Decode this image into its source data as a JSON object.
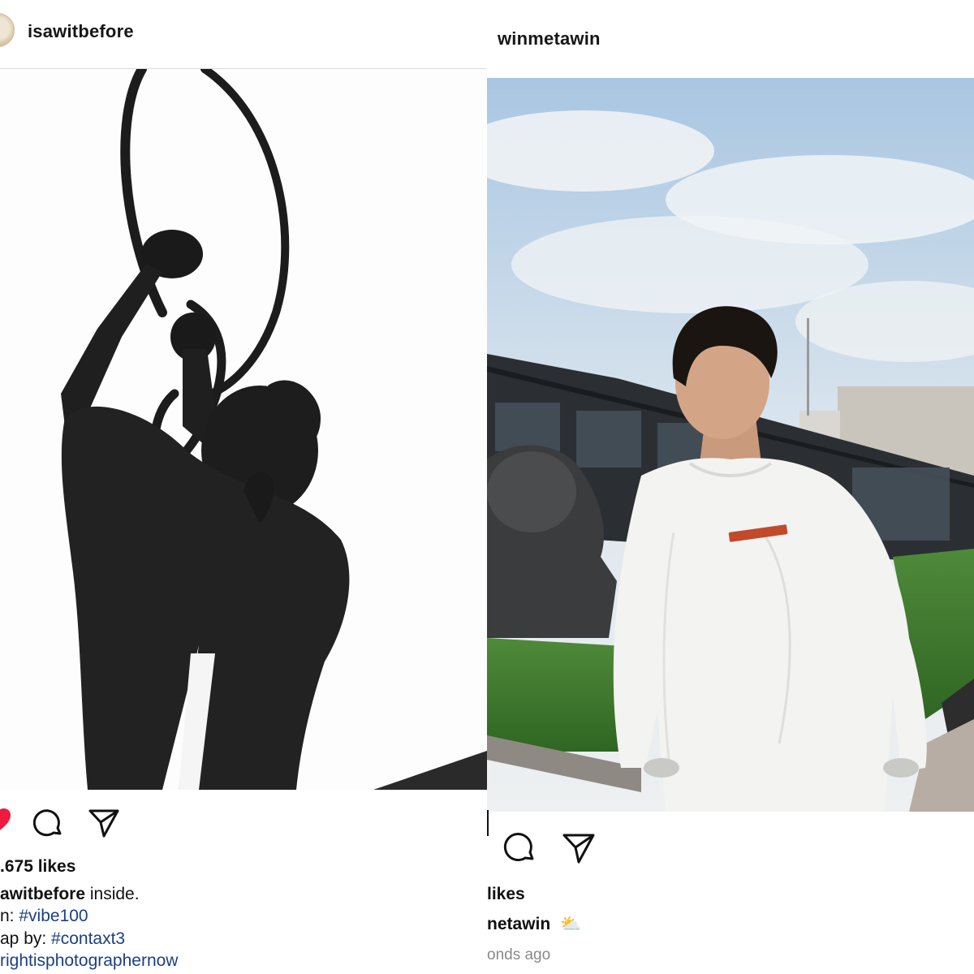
{
  "left_post": {
    "username": "isawitbefore",
    "likes": ".675 likes",
    "caption_user": "awitbefore",
    "caption_text": " inside.",
    "line2_prefix": "n: ",
    "line2_tag": "#vibe100",
    "line3_prefix": "ap by: ",
    "line3_tag": "#contaxt3",
    "line4_tag": "rightisphotographernow",
    "photo_icon": "silhouette-statue-with-rope"
  },
  "right_post": {
    "username": "winmetawin",
    "likes": "likes",
    "caption_user": "netawin",
    "caption_emoji": "⛅",
    "timestamp": "onds ago",
    "photo_icon": "man-in-white-sweatshirt-garden"
  },
  "colors": {
    "like_red": "#ed1c3f",
    "hashtag_blue": "#1b3f86",
    "text_dark": "#111111",
    "muted": "#8a8a8a"
  }
}
